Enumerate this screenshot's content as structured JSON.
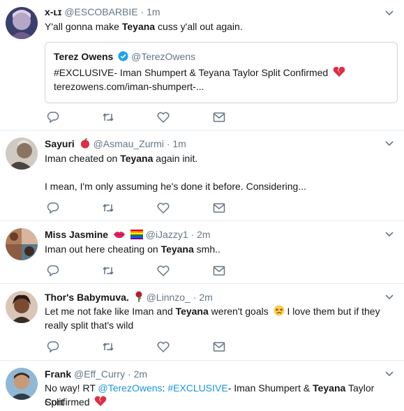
{
  "tweets": [
    {
      "name": "x-ʟɪ",
      "handle": "@ESCOBARBIE",
      "separator": "·",
      "time": "1m",
      "text_before": "Y'all gonna make ",
      "text_bold": "Teyana",
      "text_after": " cuss y'all out again.",
      "quote": {
        "name": "Terez Owens",
        "handle": "@TerezOwens",
        "text": "#EXCLUSIVE- Iman Shumpert & Teyana Taylor Split Confirmed",
        "url": "terezowens.com/iman-shumpert-..."
      }
    },
    {
      "name": "Sayuri",
      "handle": "@Asmau_Zurmi",
      "separator": "·",
      "time": "1m",
      "text_before": "Iman cheated on ",
      "text_bold": "Teyana",
      "text_after": " again init.",
      "text_line2": "I mean, I'm only assuming he's done it before. Considering..."
    },
    {
      "name": "Miss Jasmine",
      "handle": "@iJazzy1",
      "separator": "·",
      "time": "2m",
      "text_before": "Iman out here cheating on ",
      "text_bold": "Teyana",
      "text_after": " smh.."
    },
    {
      "name": "Thor's Babymuva.",
      "handle": "@Linnzo_",
      "separator": "·",
      "time": "2m",
      "text_before": "Let me not fake like Iman and ",
      "text_bold": "Teyana",
      "text_after": " weren't goals",
      "text_after2": " I love them but if they",
      "text_line2": "really split that's wild"
    },
    {
      "name": "Frank",
      "handle": "@Eff_Curry",
      "separator": "·",
      "time": "2m",
      "text_before": "No way!  RT ",
      "mention": "@TerezOwens",
      "colon": ": ",
      "hashtag": "#EXCLUSIVE",
      "text_mid": "- Iman Shumpert & ",
      "text_bold": "Teyana",
      "text_after": " Taylor Split",
      "text_line2": "Confirmed"
    }
  ],
  "icons": {
    "reply": "reply-icon",
    "retweet": "retweet-icon",
    "like": "heart-icon",
    "dm": "envelope-icon",
    "caret": "chevron-down-icon"
  },
  "colors": {
    "text": "#14171a",
    "muted": "#657786",
    "link": "#1b95e0",
    "verified": "#1da1f2",
    "border": "#e6ecf0"
  }
}
